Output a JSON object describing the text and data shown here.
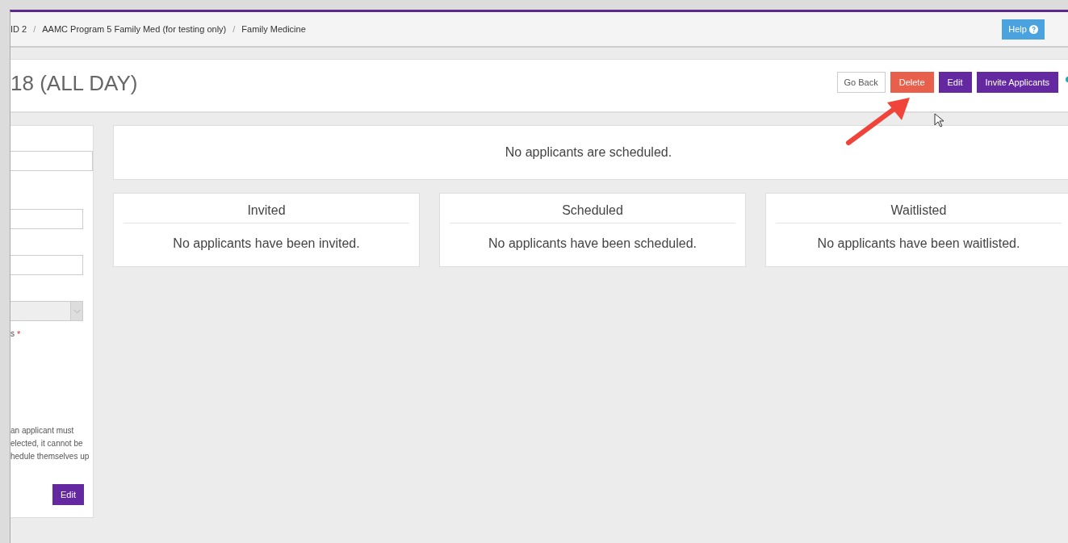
{
  "breadcrumb": [
    "ID 2",
    "AAMC Program 5 Family Med (for testing only)",
    "Family Medicine"
  ],
  "breadcrumb_separator": "/",
  "help_button": {
    "label": "Help"
  },
  "page_title": "18 (ALL DAY)",
  "actions": [
    {
      "label": "Go Back",
      "kind": "default"
    },
    {
      "label": "Delete",
      "kind": "danger"
    },
    {
      "label": "Edit",
      "kind": "primary"
    },
    {
      "label": "Invite Applicants",
      "kind": "primary"
    }
  ],
  "side_panel": {
    "fields": [
      {
        "kind": "input",
        "wide": true
      },
      {
        "kind": "input",
        "wide": false
      },
      {
        "kind": "input",
        "wide": false
      },
      {
        "kind": "select",
        "wide": false
      }
    ],
    "required_label": {
      "label": "s",
      "required_mark": "*"
    },
    "note_lines": [
      "an applicant must",
      "elected, it cannot be",
      "hedule themselves up"
    ],
    "edit_button": "Edit"
  },
  "summary": "No applicants are scheduled.",
  "cards": [
    {
      "title": "Invited",
      "message": "No applicants have been invited."
    },
    {
      "title": "Scheduled",
      "message": "No applicants have been scheduled."
    },
    {
      "title": "Waitlisted",
      "message": "No applicants have been waitlisted."
    }
  ]
}
